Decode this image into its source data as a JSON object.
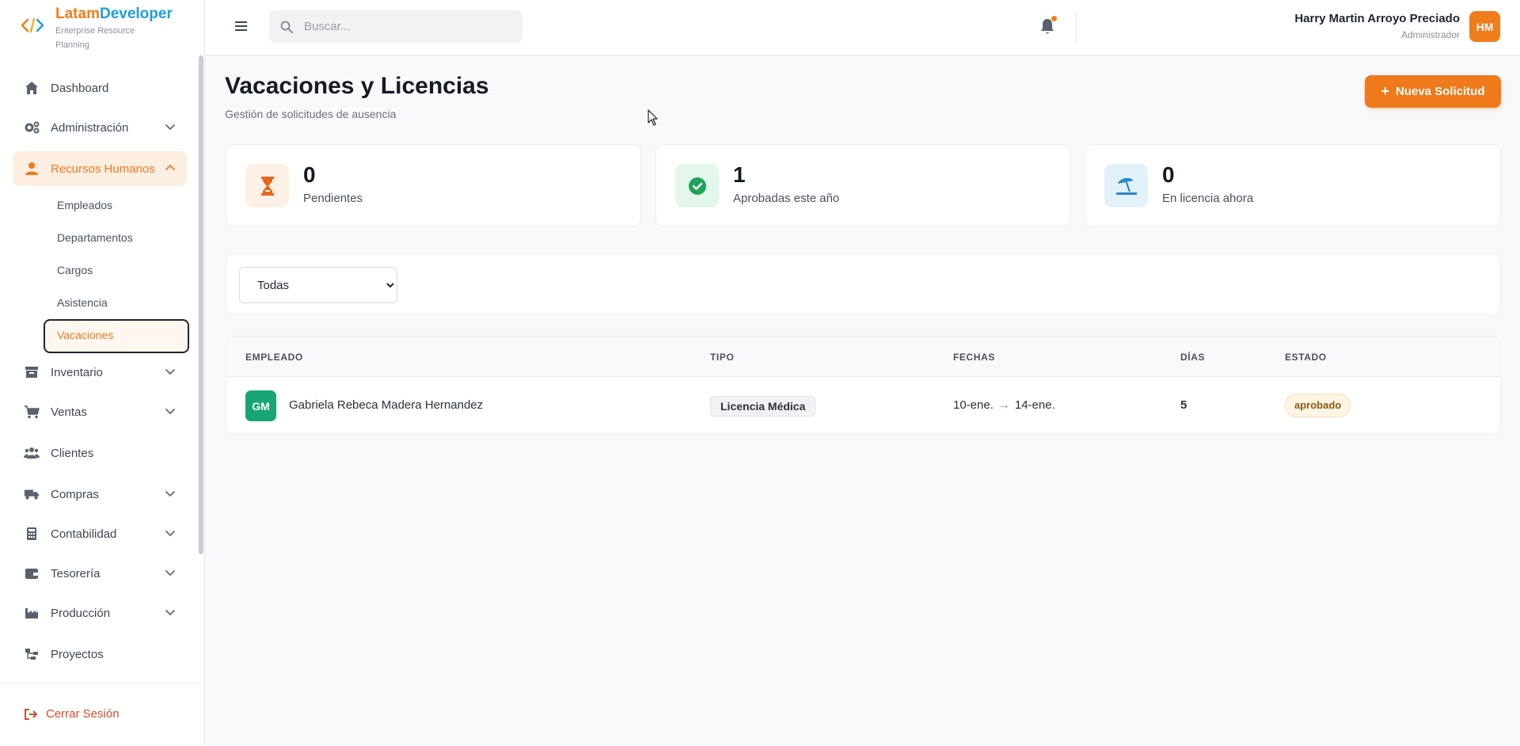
{
  "brand": {
    "name_part1": "Latam",
    "name_part2": "Developer",
    "subtitle": "Enterprise Resource Planning",
    "colors": {
      "orange": "#f07d1c",
      "blue": "#1d9fdc"
    }
  },
  "sidebar": {
    "items": [
      {
        "label": "Dashboard",
        "icon": "home-icon"
      },
      {
        "label": "Administración",
        "icon": "gears-icon",
        "expandable": true
      },
      {
        "label": "Recursos Humanos",
        "icon": "user-tie-icon",
        "expandable": true,
        "expanded": true,
        "active": true
      },
      {
        "label": "Inventario",
        "icon": "box-icon",
        "expandable": true
      },
      {
        "label": "Ventas",
        "icon": "cart-icon",
        "expandable": true
      },
      {
        "label": "Clientes",
        "icon": "users-icon"
      },
      {
        "label": "Compras",
        "icon": "truck-icon",
        "expandable": true
      },
      {
        "label": "Contabilidad",
        "icon": "calculator-icon",
        "expandable": true
      },
      {
        "label": "Tesorería",
        "icon": "wallet-icon",
        "expandable": true
      },
      {
        "label": "Producción",
        "icon": "industry-icon",
        "expandable": true
      },
      {
        "label": "Proyectos",
        "icon": "sitemap-icon"
      }
    ],
    "rrhh_subitems": [
      "Empleados",
      "Departamentos",
      "Cargos",
      "Asistencia",
      "Vacaciones"
    ],
    "active_subitem": "Vacaciones",
    "logout_label": "Cerrar Sesión"
  },
  "topbar": {
    "search_placeholder": "Buscar...",
    "user_name": "Harry Martin Arroyo Preciado",
    "user_role": "Administrador",
    "user_initials": "HM"
  },
  "page": {
    "title": "Vacaciones y Licencias",
    "subtitle": "Gestión de solicitudes de ausencia",
    "new_button_label": "Nueva Solicitud"
  },
  "stats": [
    {
      "value": "0",
      "label": "Pendientes",
      "icon": "hourglass-icon",
      "bg": "#fdf1e6",
      "color": "#e8651c"
    },
    {
      "value": "1",
      "label": "Aprobadas este año",
      "icon": "check-circle-icon",
      "bg": "#e3f7ea",
      "color": "#1fa45a"
    },
    {
      "value": "0",
      "label": "En licencia ahora",
      "icon": "umbrella-beach-icon",
      "bg": "#e3f1fb",
      "color": "#2a8ac6"
    }
  ],
  "filter": {
    "selected": "Todas",
    "options": [
      "Todas"
    ]
  },
  "table": {
    "headers": [
      "EMPLEADO",
      "TIPO",
      "FECHAS",
      "DÍAS",
      "ESTADO"
    ],
    "rows": [
      {
        "initials": "GM",
        "employee": "Gabriela Rebeca Madera Hernandez",
        "type": "Licencia Médica",
        "date_from": "10-ene.",
        "date_to": "14-ene.",
        "days": "5",
        "status": "aprobado"
      }
    ]
  }
}
